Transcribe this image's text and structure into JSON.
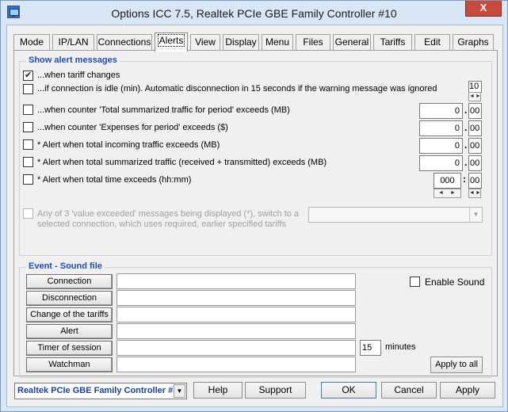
{
  "window": {
    "title": "Options ICC 7.5, Realtek PCIe GBE Family Controller #10",
    "close_glyph": "X"
  },
  "tabs": [
    {
      "label": "Mode"
    },
    {
      "label": "IP/LAN"
    },
    {
      "label": "Connections"
    },
    {
      "label": "Alerts",
      "active": true
    },
    {
      "label": "View"
    },
    {
      "label": "Display"
    },
    {
      "label": "Menu"
    },
    {
      "label": "Files"
    },
    {
      "label": "General"
    },
    {
      "label": "Tariffs"
    },
    {
      "label": "Edit"
    },
    {
      "label": "Graphs"
    }
  ],
  "alerts": {
    "title": "Show alert messages",
    "tariff_changes": {
      "label": "...when tariff changes",
      "checked": true
    },
    "idle": {
      "label": "...if connection is idle (min).  Automatic disconnection in 15 seconds if the warning message was ignored",
      "value": "10"
    },
    "traffic_period": {
      "label": "...when counter 'Total summarized traffic for period' exceeds (MB)",
      "value_int": "0",
      "value_frac": "00"
    },
    "expenses_period": {
      "label": "...when counter 'Expenses for period' exceeds ($)",
      "value_int": "0",
      "value_frac": "00"
    },
    "incoming": {
      "label": "* Alert when total incoming traffic exceeds (MB)",
      "value_int": "0",
      "value_frac": "00"
    },
    "summarized": {
      "label": "* Alert when total summarized traffic (received + transmitted) exceeds (MB)",
      "value_int": "0",
      "value_frac": "00"
    },
    "total_time": {
      "label": "* Alert when total time exceeds (hh:mm)",
      "hours": "000",
      "minutes": "00"
    },
    "switch_option": {
      "line1": "Any of 3 'value exceeded' messages being displayed (*), switch to a",
      "line2": "selected connection, which uses required, earlier specified tariffs",
      "selected": ""
    },
    "separator_dot": ".",
    "separator_colon": ":"
  },
  "sound": {
    "title": "Event - Sound file",
    "events": [
      {
        "label": "Connection",
        "file": ""
      },
      {
        "label": "Disconnection",
        "file": ""
      },
      {
        "label": "Change of the tariffs",
        "file": ""
      },
      {
        "label": "Alert",
        "file": ""
      },
      {
        "label": "Timer of session",
        "file": ""
      },
      {
        "label": "Watchman",
        "file": ""
      }
    ],
    "timer_minutes": "15",
    "minutes_label": "minutes",
    "enable_label": "Enable Sound",
    "apply_all_label": "Apply to all"
  },
  "footer": {
    "adapter": "Realtek PCIe GBE Family Controller #",
    "help": "Help",
    "support": "Support",
    "ok": "OK",
    "cancel": "Cancel",
    "apply": "Apply"
  }
}
